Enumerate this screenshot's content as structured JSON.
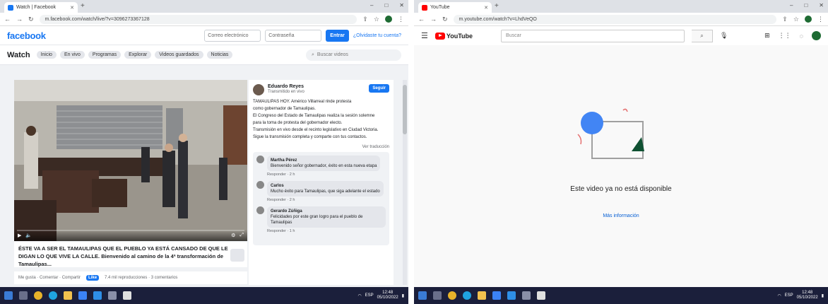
{
  "left_browser": {
    "tab_title": "Watch | Facebook",
    "url": "m.facebook.com/watch/live/?v=3096273367128",
    "facebook": {
      "logo": "facebook",
      "email_placeholder": "Correo electrónico",
      "password_placeholder": "Contraseña",
      "login_label": "Entrar",
      "forgot_label": "¿Olvidaste tu cuenta?",
      "watch_title": "Watch",
      "chips": [
        "Inicio",
        "En vivo",
        "Programas",
        "Explorar",
        "Videos guardados",
        "Noticias"
      ],
      "search_placeholder": "Buscar videos",
      "page_name": "Eduardo Reyes",
      "post_date": "Transmitido en vivo",
      "follow_label": "Seguir",
      "description": [
        "TAMAULIPAS HOY. Américo Villarreal rinde protesta",
        "como gobernador de Tamaulipas.",
        "El Congreso del Estado de Tamaulipas realiza la sesión solemne",
        "para la toma de protesta del gobernador electo.",
        "Transmisión en vivo desde el recinto legislativo en Ciudad Victoria.",
        "Sigue la transmisión completa y comparte con tus contactos."
      ],
      "see_more": "Ver traducción",
      "comments": [
        {
          "author": "Martha Pérez",
          "text": "Bienvenido señor gobernador, éxito en esta nueva etapa",
          "meta": "Responder · 2 h"
        },
        {
          "author": "Carlos",
          "text": "Mucho éxito para Tamaulipas, que siga adelante el estado",
          "meta": "Responder · 2 h"
        },
        {
          "author": "Gerardo Zúñiga",
          "text": "Felicidades por este gran logro para el pueblo de Tamaulipas",
          "meta": "Responder · 1 h"
        }
      ],
      "caption": "ÉSTE VA A SER EL TAMAULIPAS QUE EL PUEBLO YA ESTÁ CANSADO DE QUE LE DIGAN LO QUE VIVE LA CALLE. Bienvenido al camino de la 4ª transformación de Tamaulipas...",
      "action_left": "Me gusta · Comentar · Compartir",
      "like_badge": "Like",
      "action_right": "7.4 mil reproducciones · 3 comentarios"
    }
  },
  "right_browser": {
    "tab_title": "YouTube",
    "url": "m.youtube.com/watch?v=LhdVeQO",
    "youtube": {
      "logo_text": "YouTube",
      "search_placeholder": "Buscar",
      "unavailable_text": "Este video ya no está disponible",
      "link_text": "Más información"
    }
  },
  "taskbar": {
    "time": "12:48",
    "date": "05/10/2022",
    "lang": "ESP"
  }
}
